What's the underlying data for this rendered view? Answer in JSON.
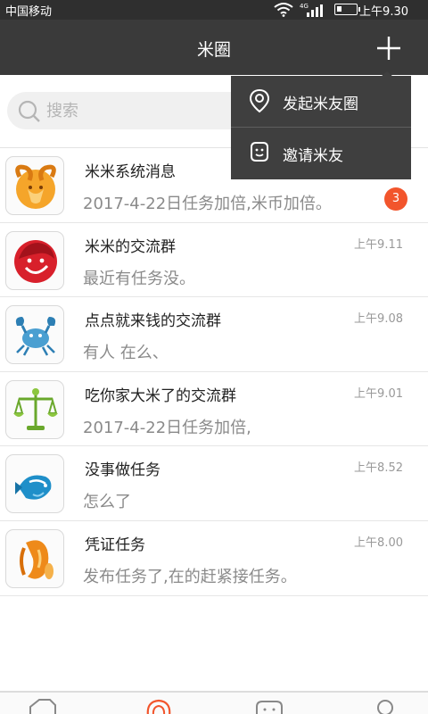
{
  "status_bar": {
    "carrier": "中国移动",
    "network": "4G",
    "time": "上午9.30"
  },
  "header": {
    "title": "米圈",
    "add_icon": "plus-icon"
  },
  "search": {
    "placeholder": "搜索",
    "icon": "search-icon"
  },
  "popup_menu": {
    "items": [
      {
        "label": "发起米友圈",
        "icon": "location-pin-icon"
      },
      {
        "label": "邀请米友",
        "icon": "smiley-icon"
      }
    ]
  },
  "chats": [
    {
      "name": "米米系统消息",
      "message": "2017-4-22日任务加倍,米币加倍。",
      "time": "",
      "badge": "3",
      "avatar": "aries-icon"
    },
    {
      "name": "米米的交流群",
      "message": "最近有任务没。",
      "time": "上午9.11",
      "badge": "",
      "avatar": "leo-icon"
    },
    {
      "name": "点点就来钱的交流群",
      "message": "有人 在么、",
      "time": "上午9.08",
      "badge": "",
      "avatar": "cancer-icon"
    },
    {
      "name": "吃你家大米了的交流群",
      "message": "2017-4-22日任务加倍,",
      "time": "上午9.01",
      "badge": "",
      "avatar": "libra-icon"
    },
    {
      "name": "没事做任务",
      "message": "怎么了",
      "time": "上午8.52",
      "badge": "",
      "avatar": "pisces-icon"
    },
    {
      "name": "凭证任务",
      "message": "发布任务了,在的赶紧接任务。",
      "time": "上午8.00",
      "badge": "",
      "avatar": "virgo-icon"
    }
  ],
  "tab_bar": {
    "tabs": [
      {
        "icon": "tag-icon"
      },
      {
        "icon": "location-pin-icon",
        "active": true
      },
      {
        "icon": "smiley-icon"
      },
      {
        "icon": "profile-icon"
      }
    ],
    "colors": {
      "active": "#f2552c",
      "inactive": "#888888"
    }
  },
  "colors": {
    "header_bg": "#3a3a3a",
    "status_bg": "#2f2f2f",
    "badge": "#f2552c",
    "popup_bg": "#3f3f3f"
  }
}
